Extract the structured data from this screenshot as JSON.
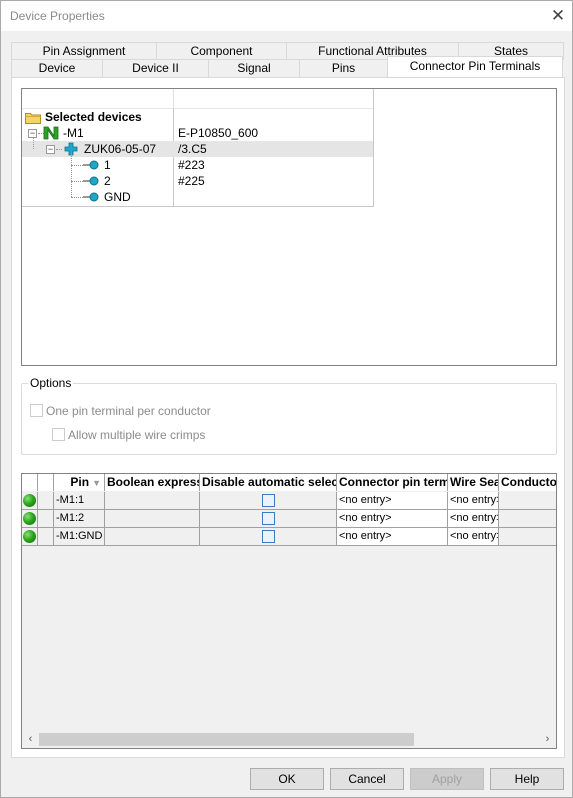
{
  "window": {
    "title": "Device Properties"
  },
  "tabs": {
    "back_row": [
      "Pin Assignment",
      "Component",
      "Functional Attributes",
      "States"
    ],
    "front_row": [
      "Device",
      "Device II",
      "Signal",
      "Pins",
      "Connector Pin Terminals"
    ],
    "active": "Connector Pin Terminals"
  },
  "tree": {
    "root_label": "Selected devices",
    "rows": [
      {
        "name": "-M1",
        "value": "E-P10850_600"
      },
      {
        "name": "ZUK06-05-07",
        "value": "/3.C5"
      },
      {
        "name": "1",
        "value": "#223"
      },
      {
        "name": "2",
        "value": "#225"
      },
      {
        "name": "GND",
        "value": ""
      }
    ]
  },
  "options": {
    "legend": "Options",
    "one_pin_terminal": "One pin terminal per conductor",
    "allow_multiple_crimps": "Allow multiple wire crimps"
  },
  "grid": {
    "headers": [
      "",
      "",
      "Pin",
      "Boolean express",
      "Disable automatic select",
      "Connector pin term",
      "Wire Sea",
      "Conductor"
    ],
    "rows": [
      {
        "pin": "-M1:1",
        "connector_pin_term": "<no entry>",
        "wire_seal": "<no entry>"
      },
      {
        "pin": "-M1:2",
        "connector_pin_term": "<no entry>",
        "wire_seal": "<no entry>"
      },
      {
        "pin": "-M1:GND",
        "connector_pin_term": "<no entry>",
        "wire_seal": "<no entry>"
      }
    ]
  },
  "buttons": {
    "ok": "OK",
    "cancel": "Cancel",
    "apply": "Apply",
    "help": "Help"
  },
  "colors": {
    "status_green": "#2ea61d",
    "tree_icon_green": "#2da12a",
    "tree_icon_cyan": "#1fa7c9",
    "folder_yellow": "#f3d46a"
  }
}
